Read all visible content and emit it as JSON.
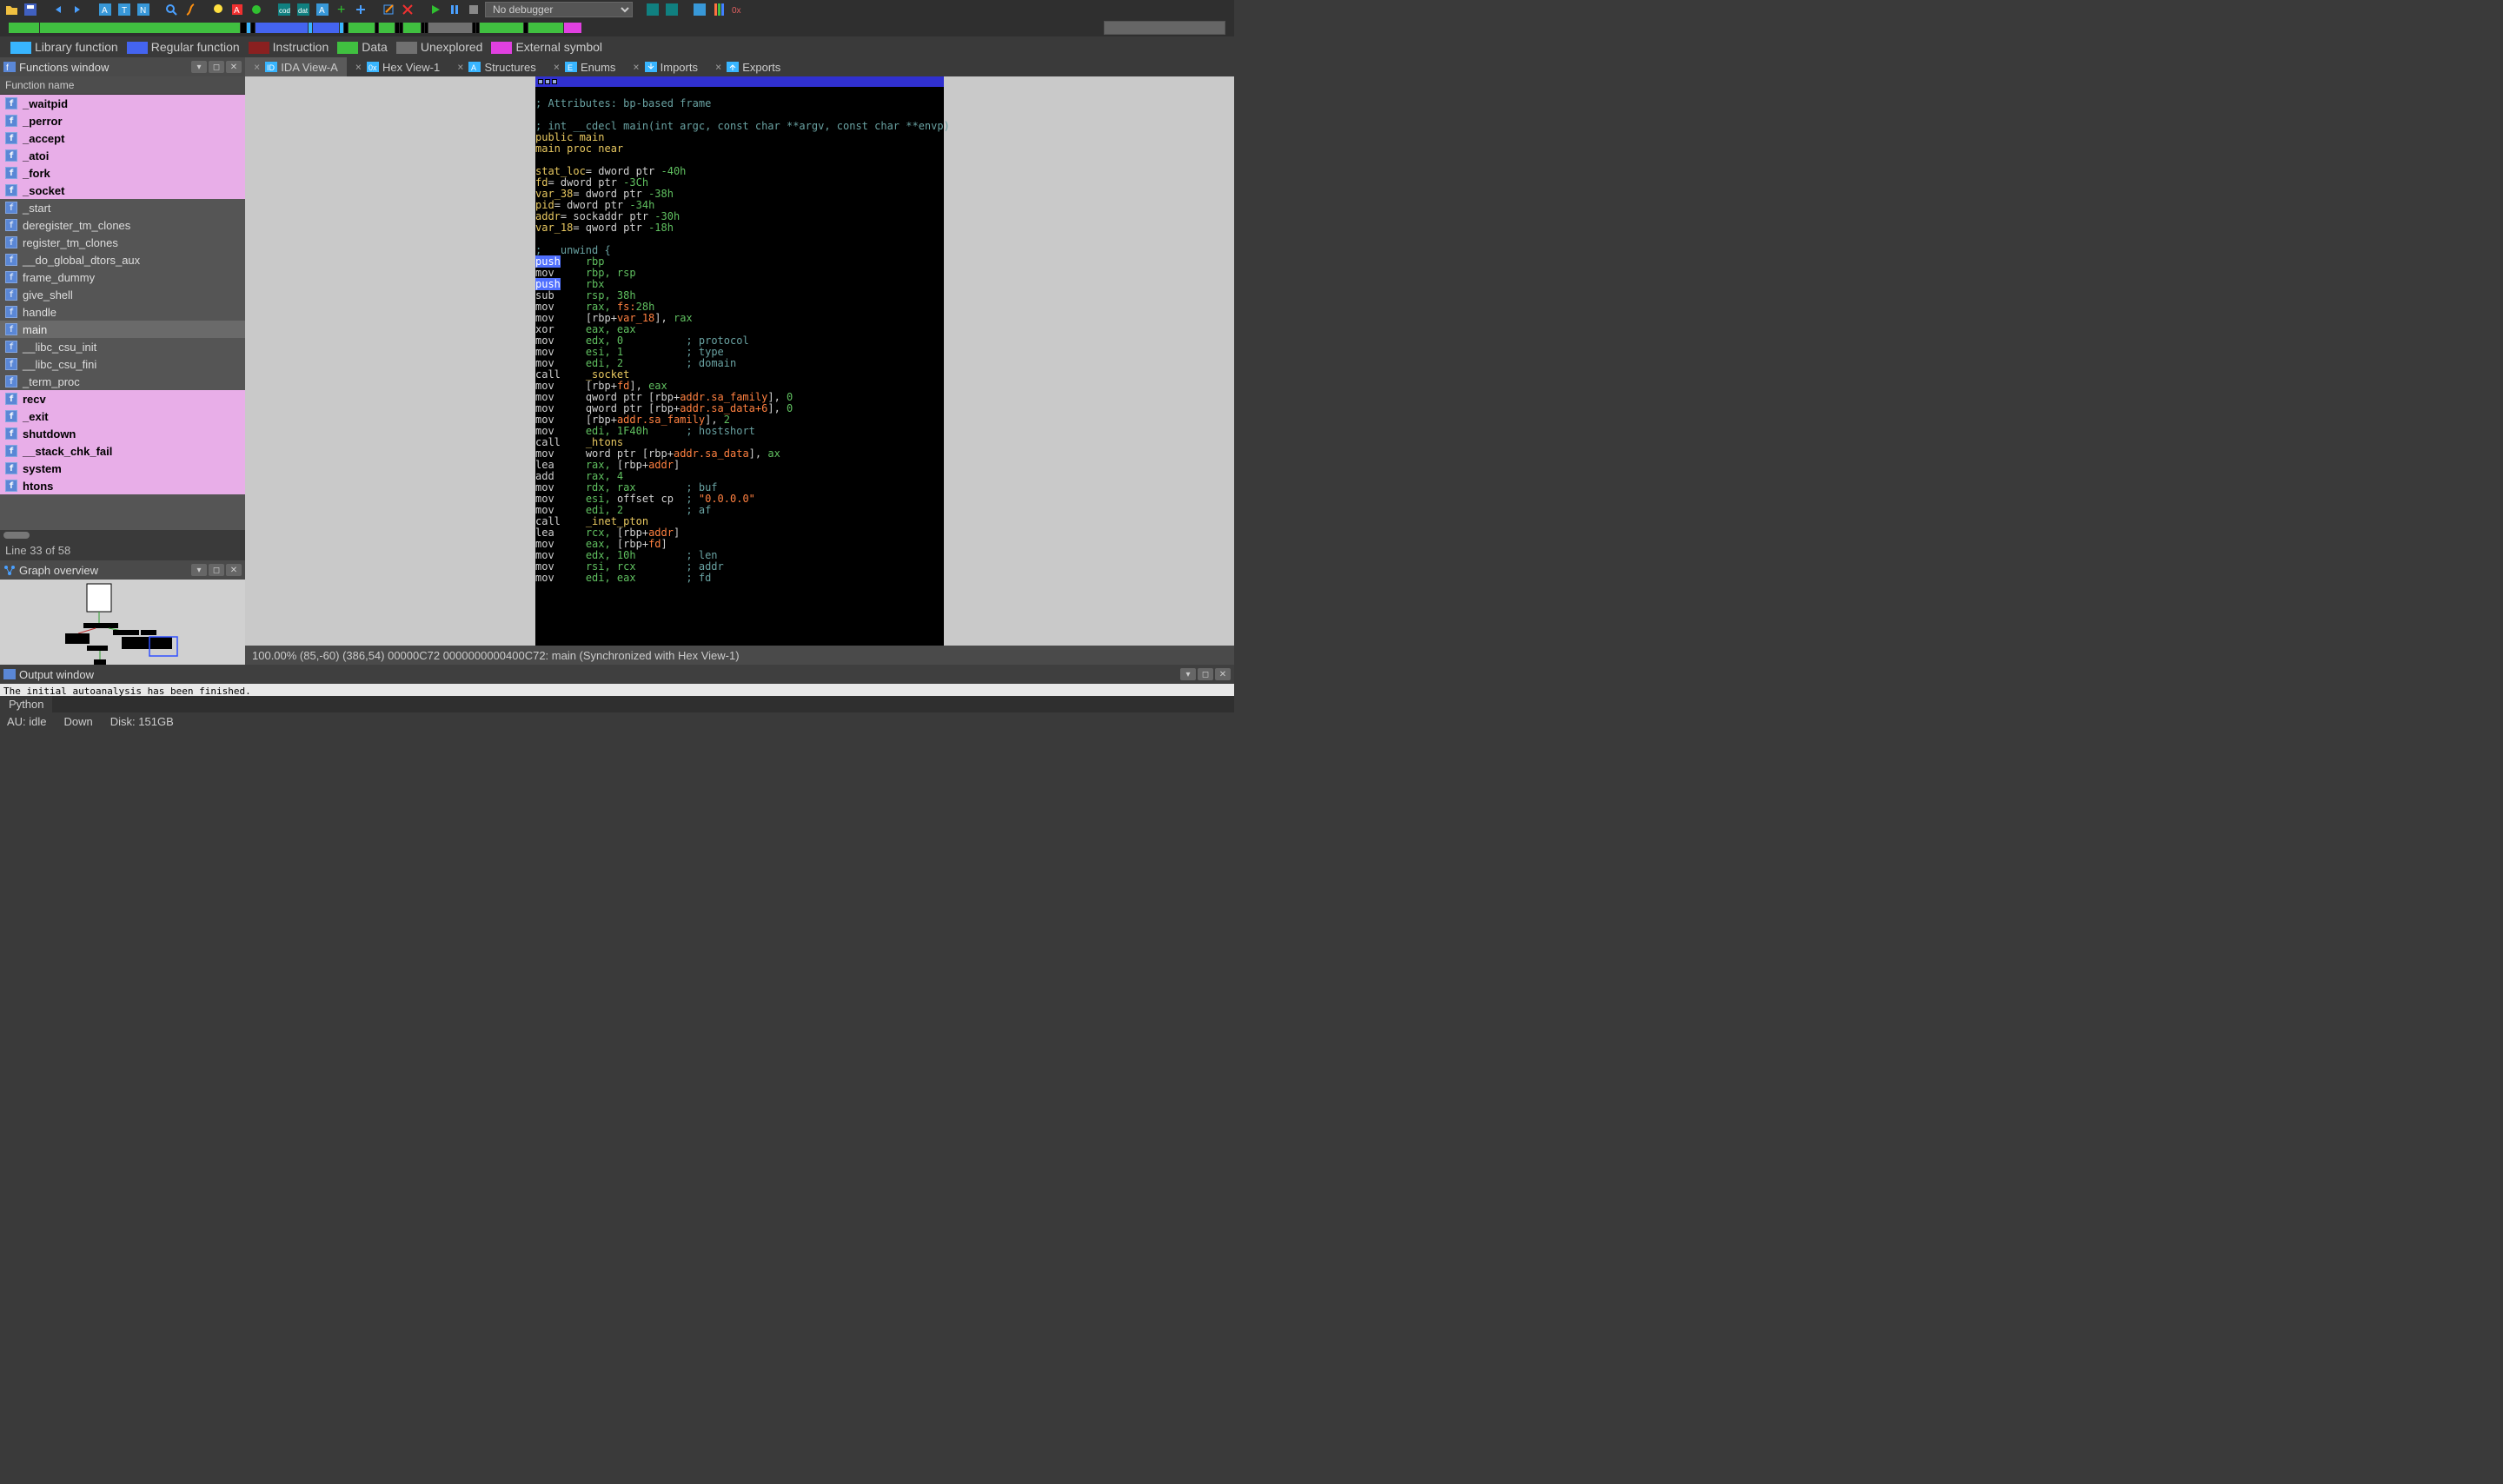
{
  "toolbar": {
    "debugger_dropdown": "No debugger"
  },
  "legend": {
    "items": [
      {
        "color": "#38b5ff",
        "label": "Library function"
      },
      {
        "color": "#4464f0",
        "label": "Regular function"
      },
      {
        "color": "#8a2020",
        "label": "Instruction"
      },
      {
        "color": "#40c040",
        "label": "Data"
      },
      {
        "color": "#707070",
        "label": "Unexplored"
      },
      {
        "color": "#e040e0",
        "label": "External symbol"
      }
    ]
  },
  "functions_window": {
    "title": "Functions window",
    "column": "Function name",
    "items": [
      {
        "name": "_waitpid",
        "style": "pink"
      },
      {
        "name": "_perror",
        "style": "pink"
      },
      {
        "name": "_accept",
        "style": "pink"
      },
      {
        "name": "_atoi",
        "style": "pink"
      },
      {
        "name": "_fork",
        "style": "pink"
      },
      {
        "name": "_socket",
        "style": "pink"
      },
      {
        "name": "_start",
        "style": "normal"
      },
      {
        "name": "deregister_tm_clones",
        "style": "normal"
      },
      {
        "name": "register_tm_clones",
        "style": "normal"
      },
      {
        "name": "__do_global_dtors_aux",
        "style": "normal"
      },
      {
        "name": "frame_dummy",
        "style": "normal"
      },
      {
        "name": "give_shell",
        "style": "normal"
      },
      {
        "name": "handle",
        "style": "normal"
      },
      {
        "name": "main",
        "style": "sel"
      },
      {
        "name": "__libc_csu_init",
        "style": "normal"
      },
      {
        "name": "__libc_csu_fini",
        "style": "normal"
      },
      {
        "name": "_term_proc",
        "style": "normal"
      },
      {
        "name": "recv",
        "style": "pink"
      },
      {
        "name": "_exit",
        "style": "pink"
      },
      {
        "name": "shutdown",
        "style": "pink"
      },
      {
        "name": "__stack_chk_fail",
        "style": "pink"
      },
      {
        "name": "system",
        "style": "pink"
      },
      {
        "name": "htons",
        "style": "pink"
      }
    ],
    "status": "Line 33 of 58"
  },
  "graph_overview": {
    "title": "Graph overview"
  },
  "tabs": [
    {
      "label": "IDA View-A",
      "active": true
    },
    {
      "label": "Hex View-1"
    },
    {
      "label": "Structures"
    },
    {
      "label": "Enums"
    },
    {
      "label": "Imports"
    },
    {
      "label": "Exports"
    }
  ],
  "status_line": "100.00%  (85,-60)  (386,54)  00000C72  0000000000400C72: main  (Synchronized with Hex View-1)",
  "output": {
    "title": "Output window",
    "text": "The initial autoanalysis has been finished.",
    "tab": "Python"
  },
  "bottom_status": {
    "au": "AU:  idle",
    "down": "Down",
    "disk": "Disk: 151GB"
  },
  "disasm": {
    "lines": [
      "",
      "<span class='c-comment'>; Attributes: bp-based frame</span>",
      "",
      "<span class='c-comment'>; int __cdecl main(int argc, const char **argv, const char **envp)</span>",
      "<span class='c-yellow'>public main</span>",
      "<span class='c-yellow'>main proc near</span>",
      "",
      "<span class='c-yellow'>stat_loc</span><span class='c-white'>= dword ptr </span><span class='c-green'>-40h</span>",
      "<span class='c-yellow'>fd</span><span class='c-white'>= dword ptr </span><span class='c-green'>-3Ch</span>",
      "<span class='c-yellow'>var_38</span><span class='c-white'>= dword ptr </span><span class='c-green'>-38h</span>",
      "<span class='c-yellow'>pid</span><span class='c-white'>= dword ptr </span><span class='c-green'>-34h</span>",
      "<span class='c-yellow'>addr</span><span class='c-white'>= sockaddr ptr </span><span class='c-green'>-30h</span>",
      "<span class='c-yellow'>var_18</span><span class='c-white'>= qword ptr </span><span class='c-green'>-18h</span>",
      "",
      "<span class='c-comment'>; __unwind {</span>",
      "<span class='c-keyword'>push</span>    <span class='c-green'>rbp</span>",
      "<span class='c-white'>mov</span>     <span class='c-green'>rbp, rsp</span>",
      "<span class='c-keyword'>push</span>    <span class='c-green'>rbx</span>",
      "<span class='c-white'>sub</span>     <span class='c-green'>rsp, 38h</span>",
      "<span class='c-white'>mov</span>     <span class='c-green'>rax, </span><span class='c-magenta'>fs:</span><span class='c-green'>28h</span>",
      "<span class='c-white'>mov</span>     <span class='c-white'>[rbp+</span><span class='c-magenta'>var_18</span><span class='c-white'>], </span><span class='c-green'>rax</span>",
      "<span class='c-white'>xor</span>     <span class='c-green'>eax, eax</span>",
      "<span class='c-white'>mov</span>     <span class='c-green'>edx, 0</span>          <span class='c-comment'>; protocol</span>",
      "<span class='c-white'>mov</span>     <span class='c-green'>esi, 1</span>          <span class='c-comment'>; type</span>",
      "<span class='c-white'>mov</span>     <span class='c-green'>edi, 2</span>          <span class='c-comment'>; domain</span>",
      "<span class='c-white'>call</span>    <span class='c-yellow'>_socket</span>",
      "<span class='c-white'>mov</span>     <span class='c-white'>[rbp+</span><span class='c-magenta'>fd</span><span class='c-white'>], </span><span class='c-green'>eax</span>",
      "<span class='c-white'>mov</span>     <span class='c-white'>qword ptr [rbp+</span><span class='c-magenta'>addr.sa_family</span><span class='c-white'>], </span><span class='c-green'>0</span>",
      "<span class='c-white'>mov</span>     <span class='c-white'>qword ptr [rbp+</span><span class='c-magenta'>addr.sa_data+6</span><span class='c-white'>], </span><span class='c-green'>0</span>",
      "<span class='c-white'>mov</span>     <span class='c-white'>[rbp+</span><span class='c-magenta'>addr.sa_family</span><span class='c-white'>], </span><span class='c-green'>2</span>",
      "<span class='c-white'>mov</span>     <span class='c-green'>edi, 1F40h</span>      <span class='c-comment'>; hostshort</span>",
      "<span class='c-white'>call</span>    <span class='c-yellow'>_htons</span>",
      "<span class='c-white'>mov</span>     <span class='c-white'>word ptr [rbp+</span><span class='c-magenta'>addr.sa_data</span><span class='c-white'>], </span><span class='c-green'>ax</span>",
      "<span class='c-white'>lea</span>     <span class='c-green'>rax, </span><span class='c-white'>[rbp+</span><span class='c-magenta'>addr</span><span class='c-white'>]</span>",
      "<span class='c-white'>add</span>     <span class='c-green'>rax, 4</span>",
      "<span class='c-white'>mov</span>     <span class='c-green'>rdx, rax</span>        <span class='c-comment'>; buf</span>",
      "<span class='c-white'>mov</span>     <span class='c-green'>esi, </span><span class='c-white'>offset cp</span>  <span class='c-comment'>; </span><span class='c-magenta'>\"0.0.0.0\"</span>",
      "<span class='c-white'>mov</span>     <span class='c-green'>edi, 2</span>          <span class='c-comment'>; af</span>",
      "<span class='c-white'>call</span>    <span class='c-yellow'>_inet_pton</span>",
      "<span class='c-white'>lea</span>     <span class='c-green'>rcx, </span><span class='c-white'>[rbp+</span><span class='c-magenta'>addr</span><span class='c-white'>]</span>",
      "<span class='c-white'>mov</span>     <span class='c-green'>eax, </span><span class='c-white'>[rbp+</span><span class='c-magenta'>fd</span><span class='c-white'>]</span>",
      "<span class='c-white'>mov</span>     <span class='c-green'>edx, 10h</span>        <span class='c-comment'>; len</span>",
      "<span class='c-white'>mov</span>     <span class='c-green'>rsi, rcx</span>        <span class='c-comment'>; addr</span>",
      "<span class='c-white'>mov</span>     <span class='c-green'>edi, eax</span>        <span class='c-comment'>; fd</span>"
    ]
  }
}
